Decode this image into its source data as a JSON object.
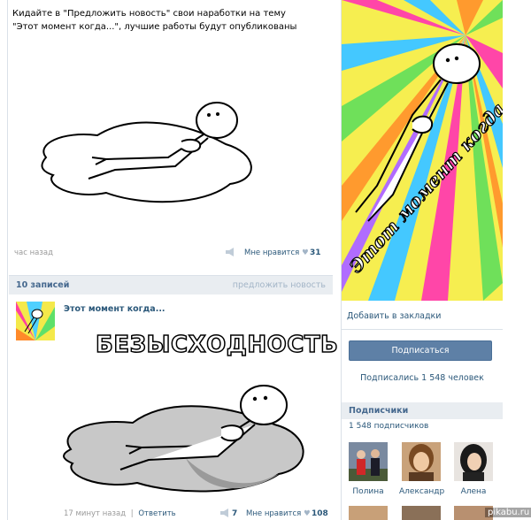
{
  "post1": {
    "text": "Кидайте в \"Предложить новость\" свои наработки на тему \"Этот момент когда...\", лучшие работы будут опубликованы",
    "time": "час назад",
    "like_label": "Мне нравится",
    "like_count": "31"
  },
  "records": {
    "count_label": "10 записей",
    "suggest_label": "предложить новость"
  },
  "post2": {
    "author": "Этот момент когда...",
    "banner": "БЕЗЫСХОДНОСТЬ",
    "time": "17 минут назад",
    "separator": "|",
    "reply_label": "Ответить",
    "share_count": "7",
    "like_label": "Мне нравится",
    "like_count": "108"
  },
  "group": {
    "image_caption": "Этот момент когда...",
    "bookmark_label": "Добавить в закладки",
    "subscribe_label": "Подписаться",
    "subscribed_text": "Подписались 1 548 человек"
  },
  "subscribers": {
    "title": "Подписчики",
    "count": "1 548 подписчиков",
    "people": [
      {
        "name": "Полина"
      },
      {
        "name": "Александр"
      },
      {
        "name": "Алена"
      }
    ]
  },
  "watermark": "pikabu.ru",
  "colors": {
    "link": "#2b587a",
    "header_bg": "#e9edf1",
    "button_bg": "#5e80a6"
  }
}
